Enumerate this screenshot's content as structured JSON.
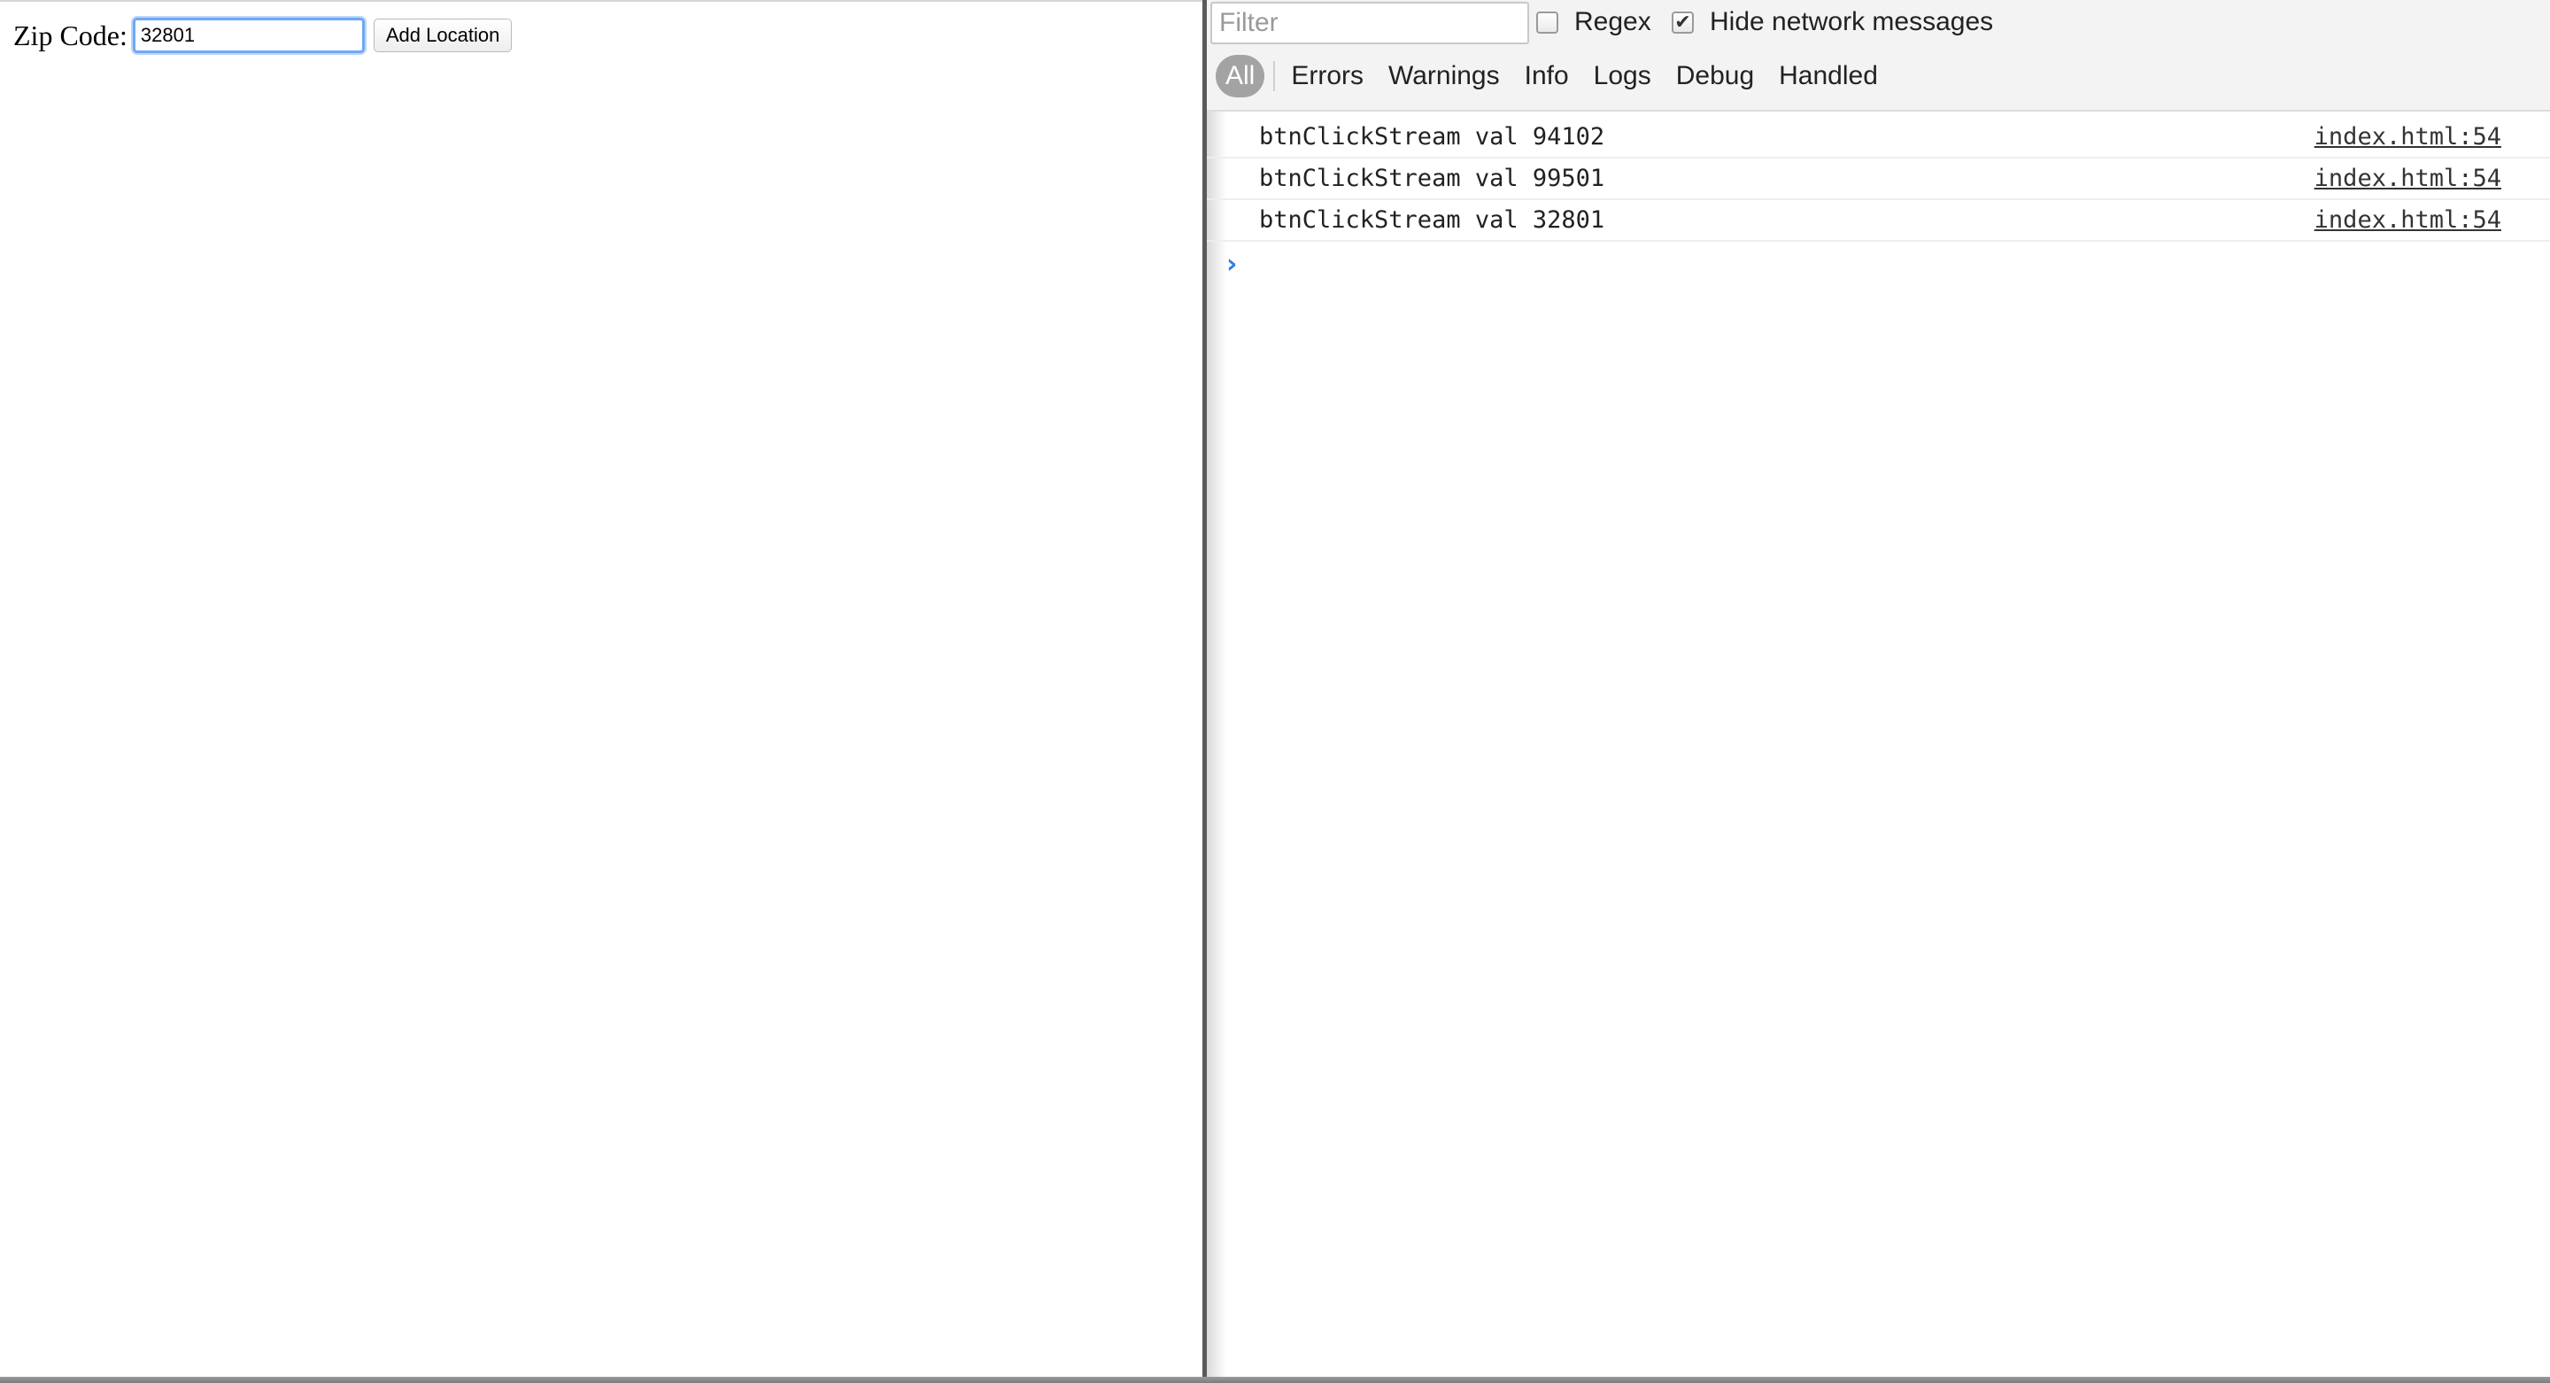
{
  "page": {
    "zip_label": "Zip Code:",
    "zip_value": "32801",
    "add_button_label": "Add Location"
  },
  "console": {
    "filter_placeholder": "Filter",
    "filter_value": "",
    "regex_label": "Regex",
    "regex_checked": false,
    "hide_network_label": "Hide network messages",
    "hide_network_checked": true,
    "levels": [
      "All",
      "Errors",
      "Warnings",
      "Info",
      "Logs",
      "Debug",
      "Handled"
    ],
    "active_level": "All",
    "messages": [
      {
        "text": "btnClickStream val 94102",
        "source": "index.html:54"
      },
      {
        "text": "btnClickStream val 99501",
        "source": "index.html:54"
      },
      {
        "text": "btnClickStream val 32801",
        "source": "index.html:54"
      }
    ],
    "prompt_icon": "chevron-right-icon",
    "accent_color": "#2f7de1"
  }
}
